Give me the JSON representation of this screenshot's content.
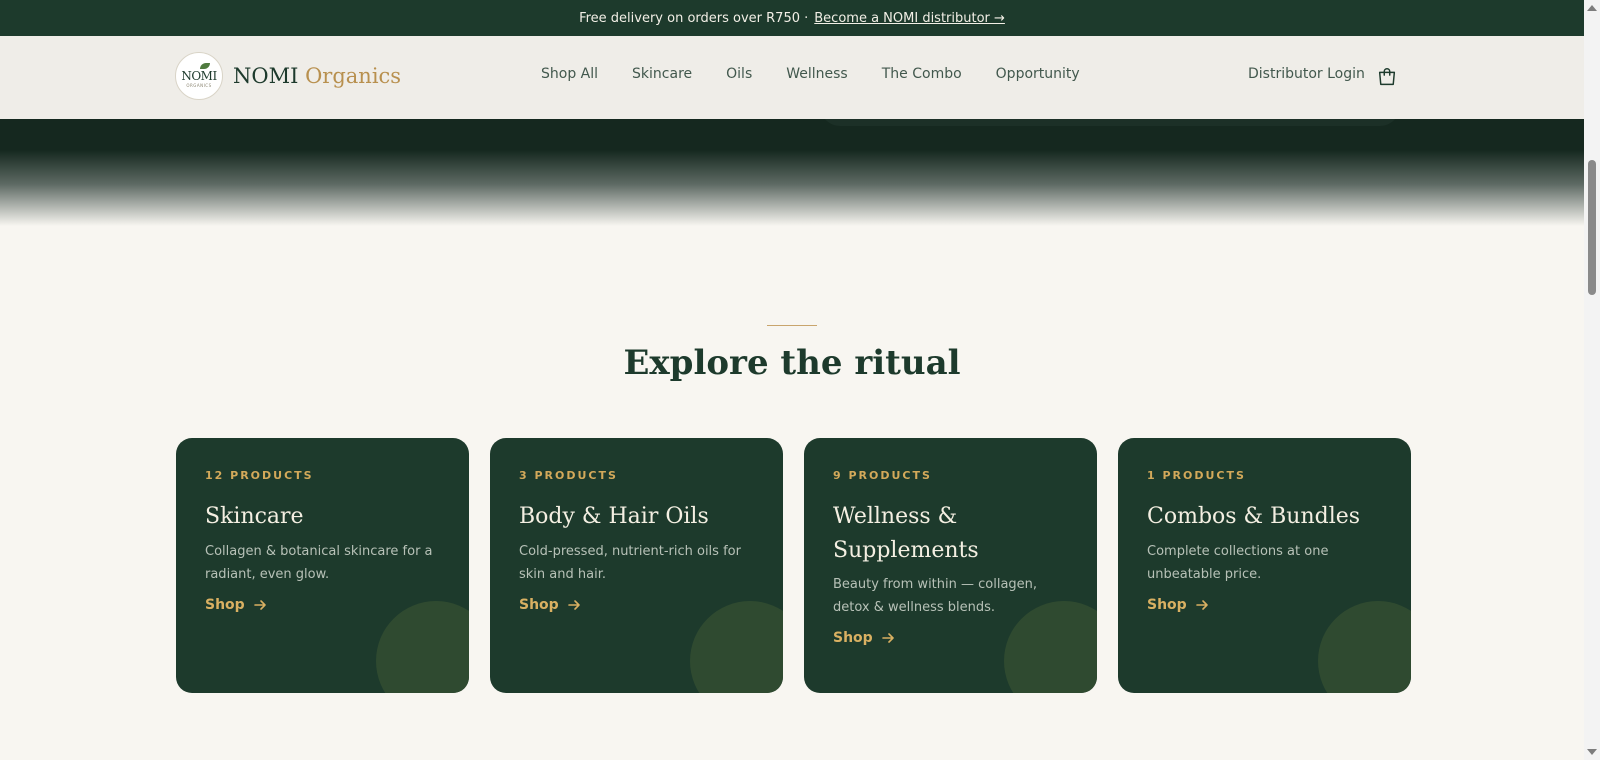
{
  "announcement": {
    "text": "Free delivery on orders over R750 ·",
    "link": "Become a NOMI distributor →"
  },
  "brand": {
    "name": "NOMI",
    "accent": "Organics",
    "badge_text": "NOMI",
    "badge_small": "ORGANICS"
  },
  "nav": {
    "items": [
      "Shop All",
      "Skincare",
      "Oils",
      "Wellness",
      "The Combo",
      "Opportunity"
    ]
  },
  "header": {
    "login": "Distributor Login",
    "cart_icon": "shopping-bag-icon"
  },
  "section": {
    "title": "Explore the ritual"
  },
  "cards": [
    {
      "count": "12 PRODUCTS",
      "title": "Skincare",
      "desc": "Collagen & botanical skincare for a radiant, even glow.",
      "cta": "Shop"
    },
    {
      "count": "3 PRODUCTS",
      "title": "Body & Hair Oils",
      "desc": "Cold-pressed, nutrient-rich oils for skin and hair.",
      "cta": "Shop"
    },
    {
      "count": "9 PRODUCTS",
      "title": "Wellness & Supplements",
      "desc": "Beauty from within — collagen, detox & wellness blends.",
      "cta": "Shop"
    },
    {
      "count": "1 PRODUCTS",
      "title": "Combos & Bundles",
      "desc": "Complete collections at one unbeatable price.",
      "cta": "Shop"
    }
  ],
  "colors": {
    "brand_green": "#1d3a2c",
    "gold": "#d3a95a",
    "cream": "#f8f6f1"
  }
}
